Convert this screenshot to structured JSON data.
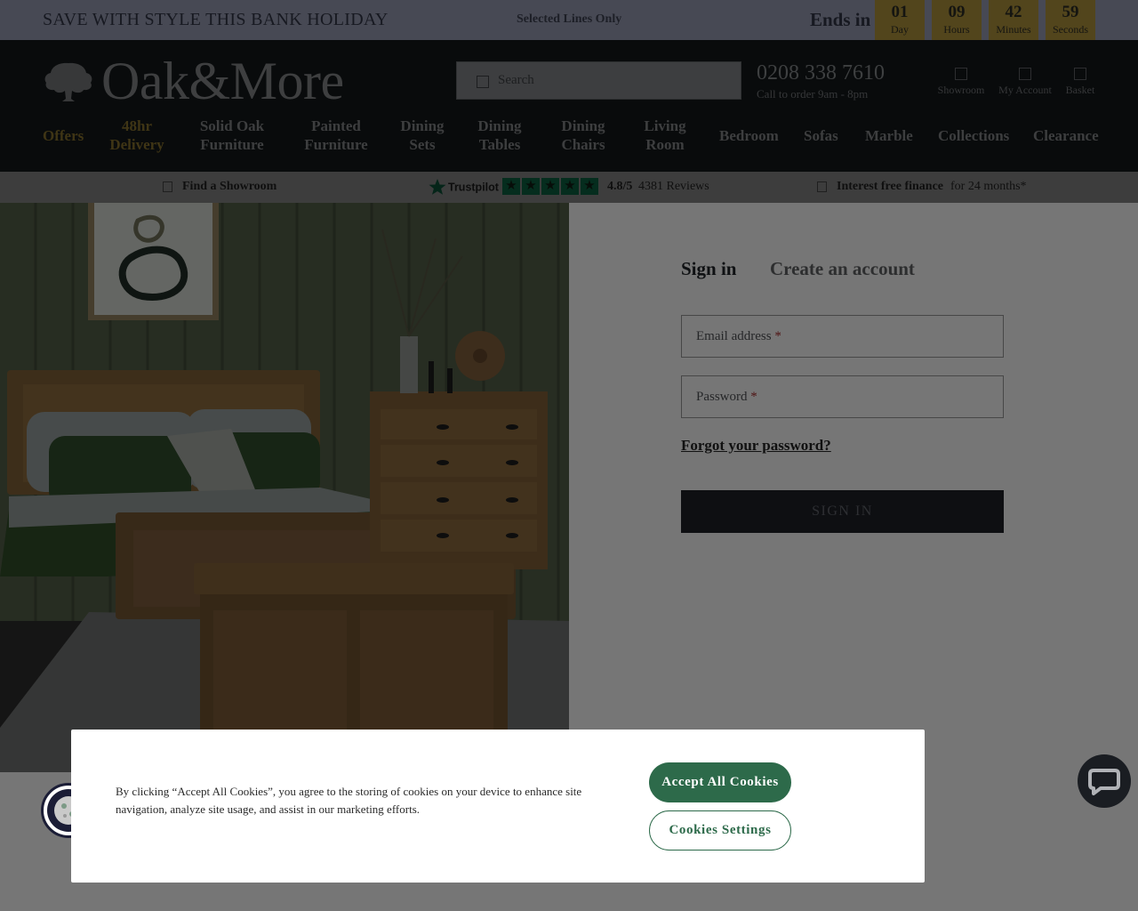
{
  "promo": {
    "title": "SAVE WITH STYLE THIS BANK HOLIDAY",
    "subtitle": "Selected Lines Only",
    "ends_label": "Ends in",
    "countdown": [
      {
        "value": "01",
        "label": "Day"
      },
      {
        "value": "09",
        "label": "Hours"
      },
      {
        "value": "42",
        "label": "Minutes"
      },
      {
        "value": "59",
        "label": "Seconds"
      }
    ]
  },
  "header": {
    "logo_text": "Oak&More",
    "search_placeholder": "Search",
    "phone": "0208 338 7610",
    "phone_sub": "Call to order 9am - 8pm",
    "icons": [
      {
        "label": "Showroom",
        "icon": "store-icon"
      },
      {
        "label": "My Account",
        "icon": "user-icon"
      },
      {
        "label": "Basket",
        "icon": "basket-icon"
      }
    ]
  },
  "nav": [
    {
      "line1": "Offers",
      "line2": ""
    },
    {
      "line1": "48hr",
      "line2": "Delivery"
    },
    {
      "line1": "Solid Oak",
      "line2": "Furniture"
    },
    {
      "line1": "Painted",
      "line2": "Furniture"
    },
    {
      "line1": "Dining",
      "line2": "Sets"
    },
    {
      "line1": "Dining",
      "line2": "Tables"
    },
    {
      "line1": "Dining",
      "line2": "Chairs"
    },
    {
      "line1": "Living",
      "line2": "Room"
    },
    {
      "line1": "Bedroom",
      "line2": ""
    },
    {
      "line1": "Sofas",
      "line2": ""
    },
    {
      "line1": "Marble",
      "line2": ""
    },
    {
      "line1": "Collections",
      "line2": ""
    },
    {
      "line1": "Clearance",
      "line2": ""
    }
  ],
  "trust": {
    "showroom": "Find a Showroom",
    "trustpilot": "Trustpilot",
    "rating": "4.8/5",
    "reviews": "4381 Reviews",
    "finance_bold": "Interest free finance",
    "finance_rest": "for 24 months*"
  },
  "form": {
    "tab_signin": "Sign in",
    "tab_create": "Create an account",
    "email_label": "Email address",
    "password_label": "Password",
    "required_mark": "*",
    "forgot": "Forgot your password?",
    "submit": "SIGN IN"
  },
  "cookie": {
    "text": "By clicking “Accept All Cookies”, you agree to the storing of cookies on your device to enhance site navigation, analyze site usage, and assist in our marketing efforts.",
    "accept": "Accept All Cookies",
    "settings": "Cookies Settings"
  },
  "colors": {
    "header_bg": "#262b2f",
    "promo_bg": "#e0e4fa",
    "gold": "#fcd274",
    "cookie_green": "#2d6a4a"
  }
}
